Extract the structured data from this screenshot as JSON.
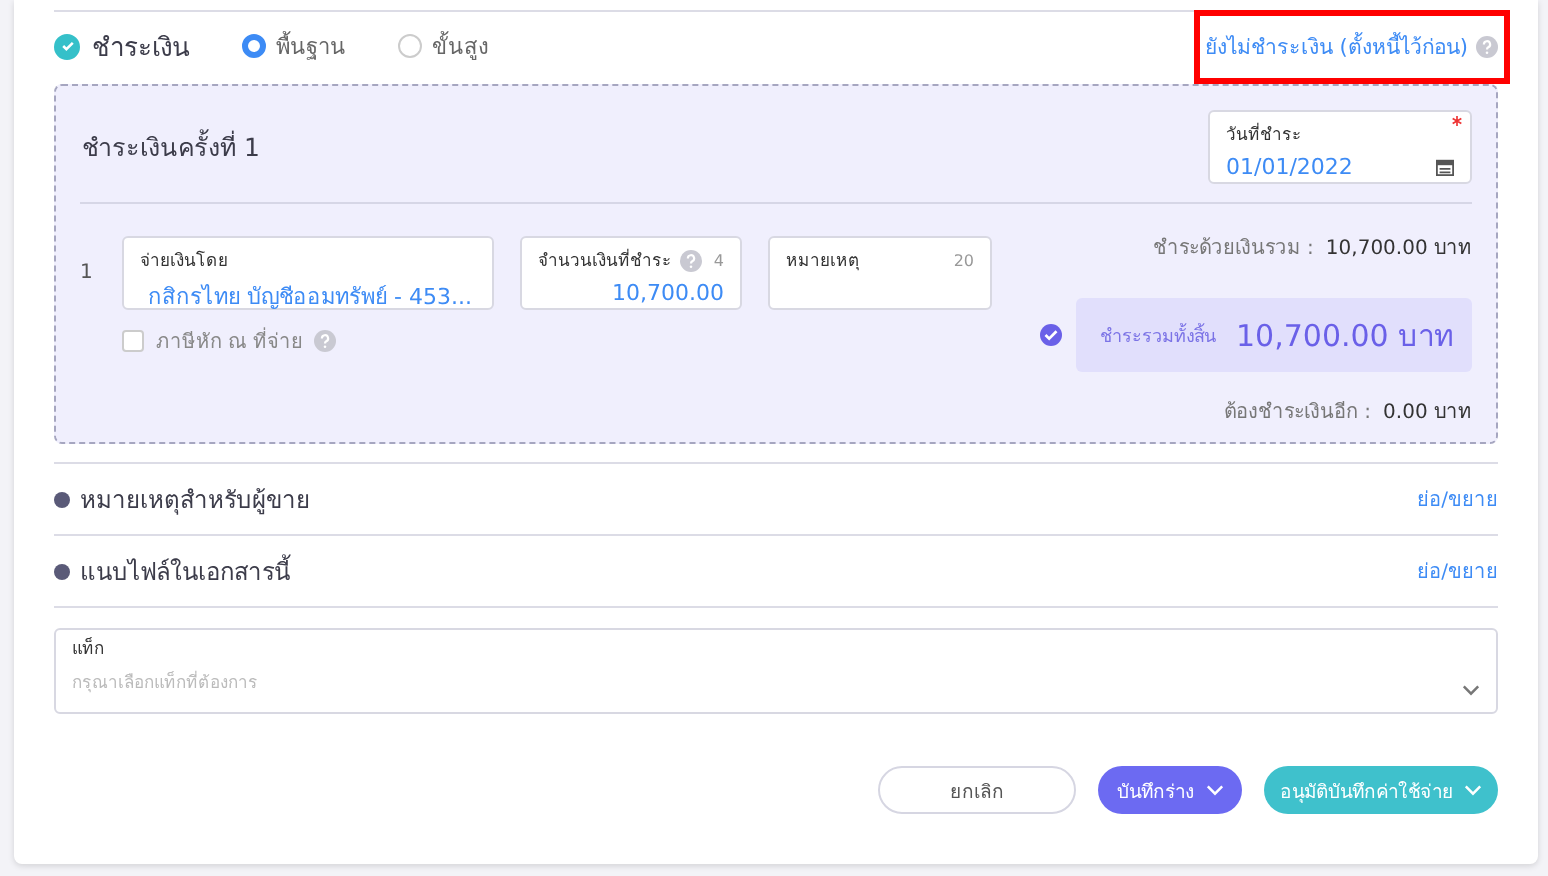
{
  "payment": {
    "label": "ชำระเงิน",
    "checked": true,
    "modes": [
      {
        "label": "พื้นฐาน",
        "selected": true
      },
      {
        "label": "ขั้นสูง",
        "selected": false
      }
    ],
    "defer_link": "ยังไม่ชำระเงิน (ตั้งหนี้ไว้ก่อน)",
    "highlighted": true
  },
  "installment": {
    "title": "ชำระเงินครั้งที่ 1",
    "date_field": {
      "label": "วันที่ชำระ",
      "value": "01/01/2022",
      "required": true
    },
    "rows": [
      {
        "number": "1",
        "pay_by": {
          "label": "จ่ายเงินโดย",
          "value": "กสิกรไทย บัญชีออมทรัพย์ - 453..."
        },
        "amount": {
          "label": "จำนวนเงินที่ชำระ",
          "counter": "4",
          "value": "10,700.00"
        },
        "note": {
          "label": "หมายเหตุ",
          "counter": "20"
        },
        "withholding": {
          "label": "ภาษีหัก ณ ที่จ่าย",
          "checked": false
        }
      }
    ],
    "paid_total": {
      "label": "ชำระด้วยเงินรวม :",
      "value": "10,700.00 บาท"
    },
    "grand_total": {
      "label": "ชำระรวมทั้งสิ้น",
      "value": "10,700.00 บาท",
      "verified": true
    },
    "remaining": {
      "label": "ต้องชำระเงินอีก :",
      "value": "0.00 บาท"
    }
  },
  "sections": [
    {
      "title": "หมายเหตุสำหรับผู้ขาย",
      "toggle": "ย่อ/ขยาย"
    },
    {
      "title": "แนบไฟล์ในเอกสารนี้",
      "toggle": "ย่อ/ขยาย"
    }
  ],
  "tag_field": {
    "label": "แท็ก",
    "placeholder": "กรุณาเลือกแท็กที่ต้องการ"
  },
  "buttons": [
    {
      "label": "ยกเลิก",
      "kind": "outline"
    },
    {
      "label": "บันทึกร่าง",
      "kind": "draft"
    },
    {
      "label": "อนุมัติบันทึกค่าใช้จ่าย",
      "kind": "approve"
    }
  ]
}
